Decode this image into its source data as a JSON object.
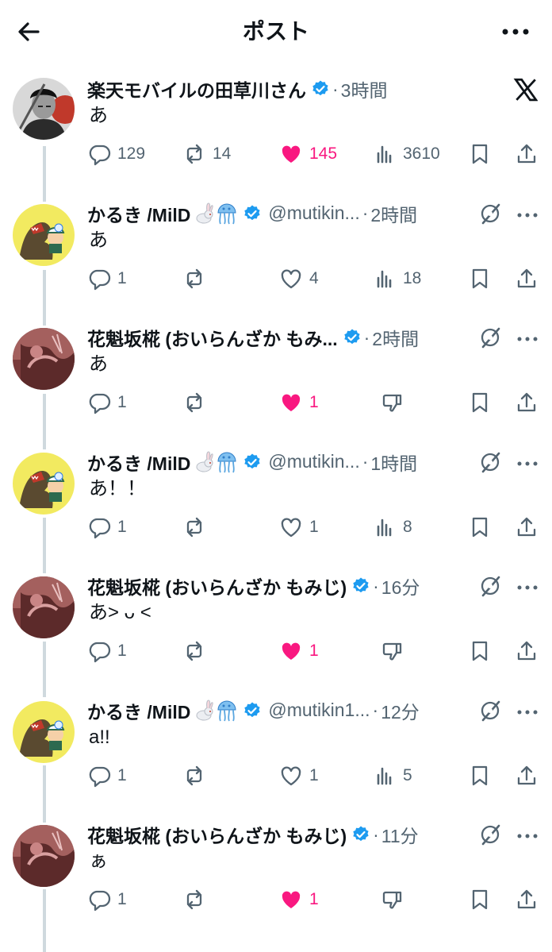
{
  "header": {
    "title": "ポスト"
  },
  "posts": [
    {
      "name": "楽天モバイルの田草川さん",
      "handle": "",
      "time": "3時間",
      "text": "あ",
      "replies": "129",
      "reposts": "14",
      "likes": "145",
      "views": "3610",
      "liked": true,
      "right": "x-logo"
    },
    {
      "name": "かるき /MilD",
      "handle": "@mutikin...",
      "time": "2時間",
      "text": "あ",
      "replies": "1",
      "reposts": "",
      "likes": "4",
      "views": "18",
      "liked": false,
      "right": "grok"
    },
    {
      "name": "花魁坂椛 (おいらんざか もみ...",
      "handle": "",
      "time": "2時間",
      "text": "あ",
      "replies": "1",
      "reposts": "",
      "likes": "1",
      "views": "",
      "liked": true,
      "right": "grok"
    },
    {
      "name": "かるき /MilD",
      "handle": "@mutikin...",
      "time": "1時間",
      "text": "あ！！",
      "replies": "1",
      "reposts": "",
      "likes": "1",
      "views": "8",
      "liked": false,
      "right": "grok"
    },
    {
      "name": "花魁坂椛 (おいらんざか もみじ)",
      "handle": "",
      "time": "16分",
      "text": "あ> ᴗ <",
      "replies": "1",
      "reposts": "",
      "likes": "1",
      "views": "",
      "liked": true,
      "right": "grok"
    },
    {
      "name": "かるき /MilD",
      "handle": "@mutikin1...",
      "time": "12分",
      "text": "a!!",
      "replies": "1",
      "reposts": "",
      "likes": "1",
      "views": "5",
      "liked": false,
      "right": "grok"
    },
    {
      "name": "花魁坂椛 (おいらんざか もみじ)",
      "handle": "",
      "time": "11分",
      "text": "ぁ",
      "replies": "1",
      "reposts": "",
      "likes": "1",
      "views": "",
      "liked": true,
      "right": "grok"
    }
  ],
  "colors": {
    "like": "#f91880",
    "verified": "#1d9bf0",
    "muted": "#536471",
    "line": "#cfd9de"
  }
}
